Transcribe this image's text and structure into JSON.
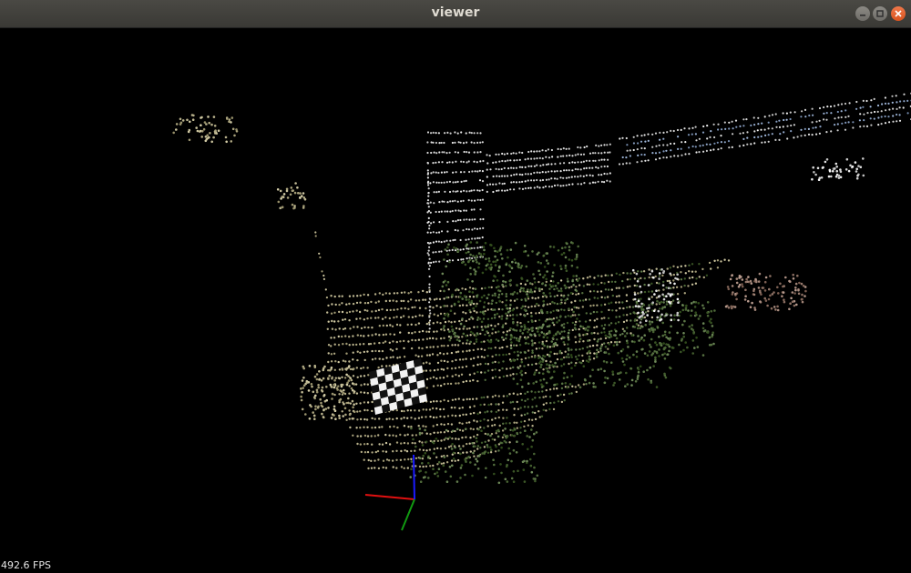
{
  "window": {
    "title": "viewer"
  },
  "controls": {
    "minimize": "minimize-icon",
    "maximize": "maximize-icon",
    "close": "close-icon"
  },
  "overlay": {
    "fps_text": "492.6 FPS"
  },
  "colors": {
    "background": "#000000",
    "axis_x": "#e01010",
    "axis_y": "#119a11",
    "axis_z": "#1a1aff",
    "ground_points": "#b7b08a",
    "vegetation_points": "#4f6a3a",
    "wall_points": "#d8d8d8",
    "window_points": "#8fa6c9",
    "checkerboard_dark": "#111111",
    "checkerboard_light": "#f2f2f2"
  }
}
